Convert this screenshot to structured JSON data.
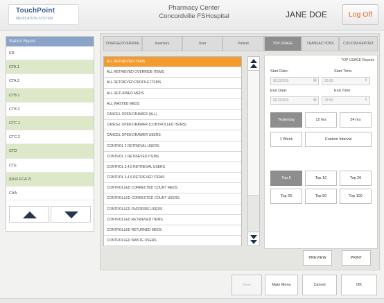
{
  "header": {
    "logo_text": "TouchPoint",
    "logo_sub": "MEDICATION SYSTEM",
    "app_line1": "Pharmacy Center",
    "app_line2": "Concordville FSHospital",
    "user_name": "JANE DOE",
    "logoff_label": "Log Off"
  },
  "stations": {
    "header": "Station Report",
    "items": [
      "ER",
      "CTA 1",
      "CTA 2",
      "CTB 1",
      "CTB 2",
      "CTC 1",
      "CTC 2",
      "CTD",
      "CTE",
      "(OLD FCA 2)",
      "CAA"
    ]
  },
  "tabs": [
    "CHARGE/OVERRIDE",
    "Inventory",
    "User",
    "Patient",
    "TOP USAGE",
    "TRANSACTIONS",
    "CUSTOM REPORT"
  ],
  "reports": [
    "ALL RETRIEVED ITEMS",
    "ALL RETRIEVED OVERRIDE ITEMS",
    "ALL RETRIEVED PROFILE ITEMS",
    "ALL RETURNED MEDS",
    "ALL WASTED MEDS",
    "CANCEL OPEN DRAWER (ALL)",
    "CANCEL OPEN DRAWER (CONTROLLED ITEMS)",
    "CANCEL OPEN DRAWER USERS",
    "CONTROL 2 RETRIEVAL USERS",
    "CONTROL 2 RETRIEVED ITEMS",
    "CONTROL 3,4,5 RETRIEVAL USERS",
    "CONTROL 3,4,5 RETRIEVED ITEMS",
    "CONTROLLED CORRECTED COUNT MEDS",
    "CONTROLLED CORRECTED COUNT USERS",
    "CONTROLLED OVERRIDE USERS",
    "CONTROLLED RETRIEVED ITEMS",
    "CONTROLLED RETURNED MEDS",
    "CONTROLLED WASTE USERS"
  ],
  "options": {
    "title": "TOP USAGE Reports",
    "start_date_label": "Start Date:",
    "start_date": "9/12/2019",
    "start_time_label": "Start Time:",
    "start_time": "00:00",
    "end_date_label": "End Date:",
    "end_date": "9/12/2019",
    "end_time_label": "End Time:",
    "end_time": "23:59",
    "range_buttons": [
      "Yesterday",
      "12 hrs",
      "24 hrs",
      "1 Week",
      "Custom Interval"
    ],
    "top_buttons": [
      "Top 5",
      "Top 10",
      "Top 20",
      "Top 25",
      "Top 50",
      "Top 100"
    ]
  },
  "actions": {
    "preview": "PREVIEW",
    "print": "PRINT",
    "save": "Save",
    "main_menu": "Main Menu",
    "cancel": "Cancel",
    "ok": "OK"
  },
  "colors": {
    "selected_report": "#f39b2c",
    "active_tab": "#8e8e8e",
    "logoff_text": "#e16a2c",
    "station_alt_row": "#dce8c8"
  }
}
